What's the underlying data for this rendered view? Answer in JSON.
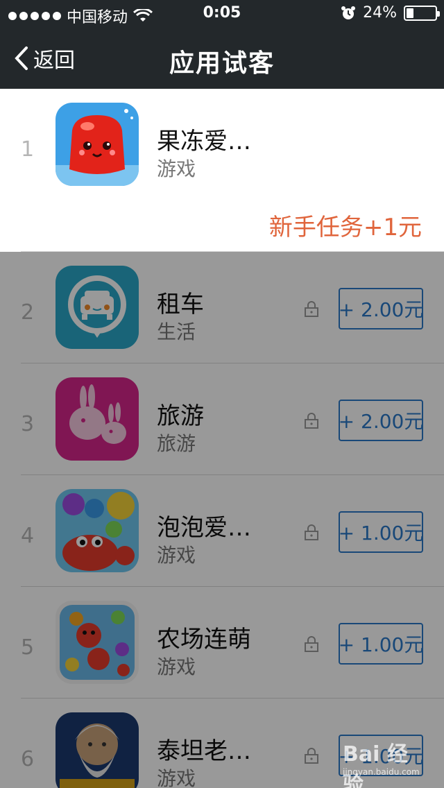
{
  "status_bar": {
    "carrier": "中国移动",
    "time": "0:05",
    "battery_percent": "24%",
    "battery_level": 0.24,
    "signal_bars": 5,
    "icons": [
      "wifi-icon",
      "alarm-icon",
      "battery-icon"
    ]
  },
  "nav": {
    "back_label": "返回",
    "title": "应用试客"
  },
  "colors": {
    "nav_bg": "#23282b",
    "task_text": "#e0653c",
    "reward_button": "#2a78c8",
    "dim_overlay": "rgba(0,0,0,0.4)"
  },
  "apps": [
    {
      "rank": "1",
      "name": "果冻爱…",
      "category": "游戏",
      "task_text": "新手任务+1元",
      "icon": "jelly-game-icon"
    },
    {
      "rank": "2",
      "name": "租车",
      "category": "生活",
      "reward": "+ 2.00元",
      "locked": true,
      "icon": "car-rental-icon"
    },
    {
      "rank": "3",
      "name": "旅游",
      "category": "旅游",
      "reward": "+ 2.00元",
      "locked": true,
      "icon": "travel-rabbit-icon"
    },
    {
      "rank": "4",
      "name": "泡泡爱…",
      "category": "游戏",
      "reward": "+ 1.00元",
      "locked": true,
      "icon": "bubble-game-icon"
    },
    {
      "rank": "5",
      "name": "农场连萌",
      "category": "游戏",
      "reward": "+ 1.00元",
      "locked": true,
      "icon": "farm-game-icon"
    },
    {
      "rank": "6",
      "name": "泰坦老…",
      "category": "游戏",
      "reward": "+ 1.00元",
      "locked": true,
      "icon": "slots-game-icon"
    }
  ],
  "watermark": {
    "brand": "Bai 经验",
    "url": "jingyan.baidu.com"
  }
}
